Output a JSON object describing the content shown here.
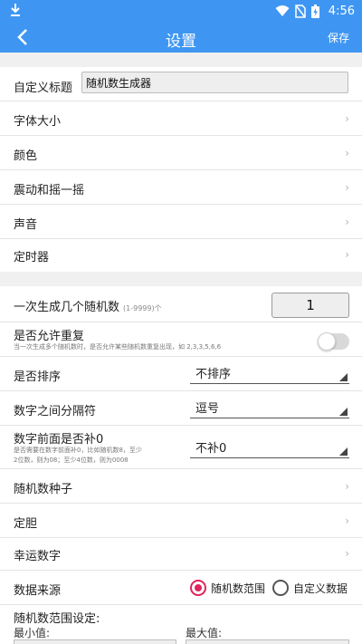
{
  "status_bar": {
    "time": "4:56"
  },
  "app_bar": {
    "title": "设置",
    "save_label": "保存"
  },
  "custom_title": {
    "label": "自定义标题",
    "value": "随机数生成器"
  },
  "menu_items": [
    {
      "label": "字体大小"
    },
    {
      "label": "颜色"
    },
    {
      "label": "震动和摇一摇"
    },
    {
      "label": "声音"
    },
    {
      "label": "定时器"
    }
  ],
  "count": {
    "label": "一次生成几个随机数",
    "hint": "(1-9999)个",
    "value": "1"
  },
  "allow_repeat": {
    "label": "是否允许重复",
    "desc": "当一次生成多个随机数时，是否允许某些随机数重复出现，如 2,3,3,5,6,6",
    "enabled": false
  },
  "sort": {
    "label": "是否排序",
    "value": "不排序"
  },
  "separator": {
    "label": "数字之间分隔符",
    "value": "逗号"
  },
  "pad_zero": {
    "label": "数字前面是否补0",
    "desc_line1": "是否需要在数字前面补0，比如随机数8，至少",
    "desc_line2": "2位数，则为08；至少4位数，则为0008",
    "value": "不补0"
  },
  "more_items": [
    {
      "label": "随机数种子"
    },
    {
      "label": "定胆"
    },
    {
      "label": "幸运数字"
    }
  ],
  "data_source": {
    "label": "数据来源",
    "options": [
      "随机数范围",
      "自定义数据"
    ],
    "selected": "随机数范围"
  },
  "range": {
    "title": "随机数范围设定:",
    "min_label": "最小值:",
    "max_label": "最大值:"
  },
  "colors": {
    "primary": "#3f96f2",
    "accent": "#e0245e"
  }
}
